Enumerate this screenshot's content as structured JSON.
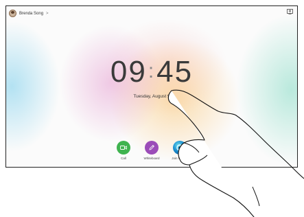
{
  "user": {
    "name": "Brenda Song",
    "chevron": ">"
  },
  "clock": {
    "hours": "09",
    "separator": ":",
    "minutes": "45"
  },
  "date": "Tuesday, August 9",
  "actions": [
    {
      "label": "Call",
      "icon": "video-camera-icon",
      "color": "#3fb34f"
    },
    {
      "label": "Whiteboard",
      "icon": "pencil-icon",
      "color": "#9b4cb8"
    },
    {
      "label": "Join Webex",
      "icon": "webex-icon",
      "color": "#1b8fd0"
    }
  ]
}
